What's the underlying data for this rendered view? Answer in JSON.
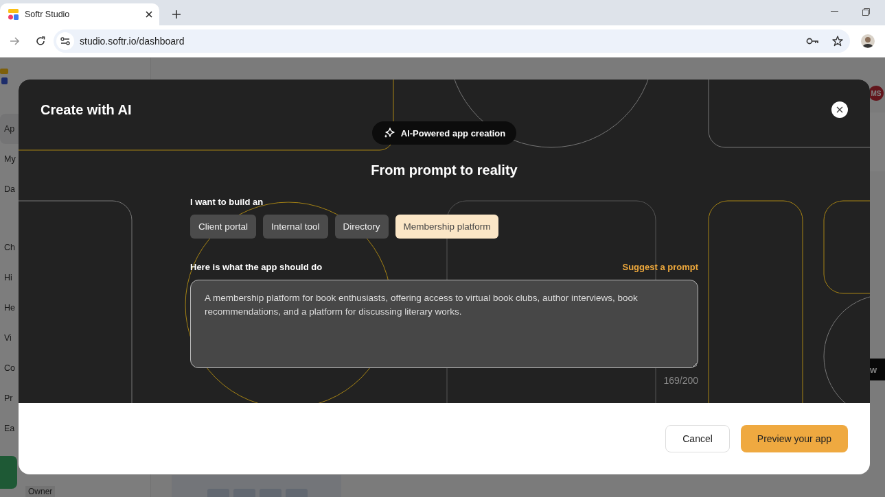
{
  "browser": {
    "tab": {
      "title": "Softr Studio",
      "selected": true
    },
    "url": "studio.softr.io/dashboard"
  },
  "backdrop": {
    "sidebar_items": [
      "Ap",
      "My",
      "Da",
      "Ch",
      "Hi",
      "He",
      "Vi",
      "Co",
      "Pr",
      "Ea"
    ],
    "owner_badge": "Owner",
    "avatar": "MS",
    "button_fragment": "w"
  },
  "modal": {
    "title": "Create with AI",
    "badge": "AI-Powered app creation",
    "heading": "From prompt to reality",
    "build_label": "I want to build an",
    "app_types": [
      {
        "label": "Client portal",
        "selected": false
      },
      {
        "label": "Internal tool",
        "selected": false
      },
      {
        "label": "Directory",
        "selected": false
      },
      {
        "label": "Membership platform",
        "selected": true
      }
    ],
    "prompt_label": "Here is what the app should do",
    "suggest_link": "Suggest a prompt",
    "prompt_text": "A membership platform for book enthusiasts, offering access to virtual book clubs, author interviews, book recommendations, and a platform for discussing literary works.",
    "counter": "169/200",
    "buttons": [
      {
        "label": "Cancel",
        "kind": "secondary"
      },
      {
        "label": "Preview your app",
        "kind": "primary"
      }
    ]
  }
}
